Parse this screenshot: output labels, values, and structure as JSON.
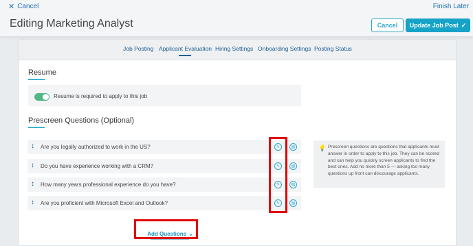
{
  "header": {
    "cancel_label": "Cancel",
    "finish_later_label": "Finish Later",
    "title": "Editing Marketing Analyst",
    "cancel_button": "Cancel",
    "update_button": "Update Job Post",
    "update_icon": "check-icon"
  },
  "tabs": [
    {
      "label": "Job Posting"
    },
    {
      "label": "Applicant Evaluation",
      "active": true
    },
    {
      "label": "Hiring Settings"
    },
    {
      "label": "Onboarding Settings"
    },
    {
      "label": "Posting Status"
    }
  ],
  "resume": {
    "section_title": "Resume",
    "toggle_on": true,
    "toggle_label": "Resume is required to apply to this job"
  },
  "prescreen": {
    "section_title": "Prescreen Questions (Optional)",
    "questions": [
      {
        "text": "Are you legally authorized to work in the US?"
      },
      {
        "text": "Do you have experience working with a CRM?"
      },
      {
        "text": "How many years professional experience do you have?"
      },
      {
        "text": "Are you proficient with Microsoft Excel and Outlook?"
      }
    ],
    "info_text": "Prescreen questions are questions that applicants must answer in order to apply to this job. They can be scored and can help you quickly screen applicants to find the best ones. Add no more than 5 — asking too many questions up front can discourage applicants.",
    "add_button": "Add Questions",
    "add_icon": "chevron-down-icon"
  },
  "colors": {
    "accent": "#17a3c8",
    "link": "#1b6fb8",
    "highlight": "#e00000",
    "toggle_on": "#52b788"
  }
}
